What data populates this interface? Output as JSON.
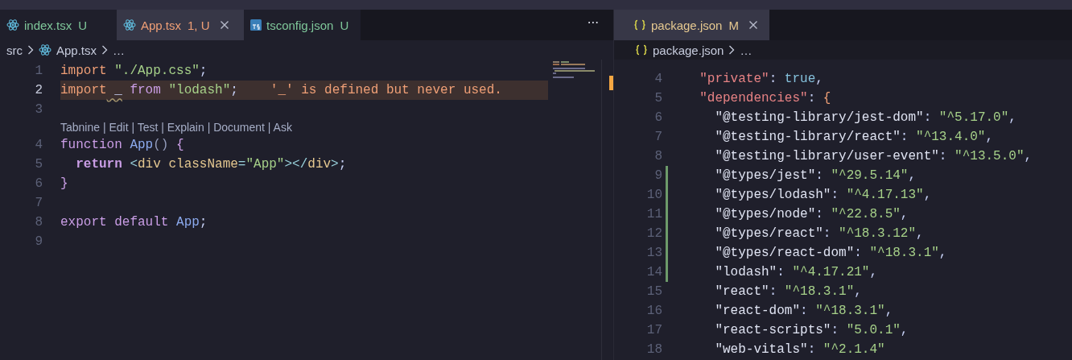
{
  "editor_groups": [
    {
      "tabs": [
        {
          "label": "index.tsx",
          "kind": "react",
          "badge": "U",
          "color": "#7fc79a",
          "selected": false,
          "closable": false
        },
        {
          "label": "App.tsx",
          "kind": "react",
          "badge": "1, U",
          "color": "#ef9f76",
          "selected": true,
          "closable": true
        },
        {
          "label": "tsconfig.json",
          "kind": "typescript",
          "badge": "U",
          "color": "#7fc79a",
          "selected": false,
          "closable": false
        }
      ],
      "more_actions": "···",
      "breadcrumb": [
        {
          "label": "src",
          "kind": "folder"
        },
        {
          "label": "App.tsx",
          "kind": "react"
        },
        {
          "label": "…",
          "kind": "more"
        }
      ],
      "lines": [
        {
          "kind": "code",
          "number": "1",
          "current": false,
          "tokens": [
            {
              "text": "import",
              "kind": "import"
            },
            {
              "text": " \"./App.css\"",
              "kind": "string"
            },
            {
              "text": ";",
              "kind": "plain"
            }
          ]
        },
        {
          "kind": "code",
          "number": "2",
          "current": true,
          "diagnostic": {
            "message": "'_' is defined but never used."
          },
          "tokens": [
            {
              "text": "import",
              "kind": "import"
            },
            {
              "text": " _",
              "kind": "unused"
            },
            {
              "text": " from",
              "kind": "keyword"
            },
            {
              "text": " \"lodash\"",
              "kind": "string"
            },
            {
              "text": ";",
              "kind": "plain"
            }
          ]
        },
        {
          "kind": "code",
          "number": "3",
          "current": false
        },
        {
          "kind": "codelens",
          "text": "Tabnine | Edit | Test | Explain | Document | Ask"
        },
        {
          "kind": "code",
          "number": "4",
          "current": false,
          "tokens": [
            {
              "text": "function",
              "kind": "keyword"
            },
            {
              "text": " App",
              "kind": "func"
            },
            {
              "text": "()",
              "kind": "punct"
            },
            {
              "text": " {",
              "kind": "brace"
            }
          ]
        },
        {
          "kind": "code",
          "number": "5",
          "current": false,
          "tokens": [
            {
              "text": "  return",
              "kind": "bold_keyword"
            },
            {
              "text": " <",
              "kind": "tagpunct"
            },
            {
              "text": "div",
              "kind": "tag"
            },
            {
              "text": " className",
              "kind": "attr"
            },
            {
              "text": "=",
              "kind": "tagpunct"
            },
            {
              "text": "\"App\"",
              "kind": "string"
            },
            {
              "text": "></",
              "kind": "tagpunct"
            },
            {
              "text": "div",
              "kind": "tag"
            },
            {
              "text": ">",
              "kind": "tagpunct"
            },
            {
              "text": ";",
              "kind": "plain"
            }
          ]
        },
        {
          "kind": "code",
          "number": "6",
          "current": false,
          "tokens": [
            {
              "text": "}",
              "kind": "brace"
            }
          ]
        },
        {
          "kind": "code",
          "number": "7",
          "current": false
        },
        {
          "kind": "code",
          "number": "8",
          "current": false,
          "tokens": [
            {
              "text": "export",
              "kind": "keyword"
            },
            {
              "text": " default",
              "kind": "keyword"
            },
            {
              "text": " App",
              "kind": "func"
            },
            {
              "text": ";",
              "kind": "plain"
            }
          ]
        },
        {
          "kind": "code",
          "number": "9",
          "current": false
        }
      ]
    },
    {
      "tabs": [
        {
          "label": "package.json",
          "kind": "json",
          "badge": "M",
          "color": "#e5c890",
          "selected": true,
          "closable": true
        }
      ],
      "breadcrumb": [
        {
          "label": "package.json",
          "kind": "json"
        },
        {
          "label": "…",
          "kind": "more"
        }
      ],
      "lines": [
        {
          "kind": "code",
          "number": "4",
          "current": false,
          "git_added": false,
          "tokens": [
            {
              "text": "  \"private\"",
              "kind": "key"
            },
            {
              "text": ":",
              "kind": "plain"
            },
            {
              "text": " true",
              "kind": "bool"
            },
            {
              "text": ",",
              "kind": "plain"
            }
          ]
        },
        {
          "kind": "code",
          "number": "5",
          "current": false,
          "git_added": false,
          "tokens": [
            {
              "text": "  \"dependencies\"",
              "kind": "key"
            },
            {
              "text": ":",
              "kind": "plain"
            },
            {
              "text": " {",
              "kind": "brace_orange"
            }
          ]
        },
        {
          "kind": "code",
          "number": "6",
          "current": false,
          "git_added": false,
          "tokens": [
            {
              "text": "    \"@testing-library/jest-dom\"",
              "kind": "nested_key"
            },
            {
              "text": ":",
              "kind": "plain"
            },
            {
              "text": " \"^5.17.0\"",
              "kind": "string"
            },
            {
              "text": ",",
              "kind": "plain"
            }
          ]
        },
        {
          "kind": "code",
          "number": "7",
          "current": false,
          "git_added": false,
          "tokens": [
            {
              "text": "    \"@testing-library/react\"",
              "kind": "nested_key"
            },
            {
              "text": ":",
              "kind": "plain"
            },
            {
              "text": " \"^13.4.0\"",
              "kind": "string"
            },
            {
              "text": ",",
              "kind": "plain"
            }
          ]
        },
        {
          "kind": "code",
          "number": "8",
          "current": false,
          "git_added": false,
          "tokens": [
            {
              "text": "    \"@testing-library/user-event\"",
              "kind": "nested_key"
            },
            {
              "text": ":",
              "kind": "plain"
            },
            {
              "text": " \"^13.5.0\"",
              "kind": "string"
            },
            {
              "text": ",",
              "kind": "plain"
            }
          ]
        },
        {
          "kind": "code",
          "number": "9",
          "current": false,
          "git_added": true,
          "tokens": [
            {
              "text": "    \"@types/jest\"",
              "kind": "nested_key"
            },
            {
              "text": ":",
              "kind": "plain"
            },
            {
              "text": " \"^29.5.14\"",
              "kind": "string"
            },
            {
              "text": ",",
              "kind": "plain"
            }
          ]
        },
        {
          "kind": "code",
          "number": "10",
          "current": false,
          "git_added": true,
          "tokens": [
            {
              "text": "    \"@types/lodash\"",
              "kind": "nested_key"
            },
            {
              "text": ":",
              "kind": "plain"
            },
            {
              "text": " \"^4.17.13\"",
              "kind": "string"
            },
            {
              "text": ",",
              "kind": "plain"
            }
          ]
        },
        {
          "kind": "code",
          "number": "11",
          "current": false,
          "git_added": true,
          "tokens": [
            {
              "text": "    \"@types/node\"",
              "kind": "nested_key"
            },
            {
              "text": ":",
              "kind": "plain"
            },
            {
              "text": " \"^22.8.5\"",
              "kind": "string"
            },
            {
              "text": ",",
              "kind": "plain"
            }
          ]
        },
        {
          "kind": "code",
          "number": "12",
          "current": false,
          "git_added": true,
          "tokens": [
            {
              "text": "    \"@types/react\"",
              "kind": "nested_key"
            },
            {
              "text": ":",
              "kind": "plain"
            },
            {
              "text": " \"^18.3.12\"",
              "kind": "string"
            },
            {
              "text": ",",
              "kind": "plain"
            }
          ]
        },
        {
          "kind": "code",
          "number": "13",
          "current": false,
          "git_added": true,
          "tokens": [
            {
              "text": "    \"@types/react-dom\"",
              "kind": "nested_key"
            },
            {
              "text": ":",
              "kind": "plain"
            },
            {
              "text": " \"^18.3.1\"",
              "kind": "string"
            },
            {
              "text": ",",
              "kind": "plain"
            }
          ]
        },
        {
          "kind": "code",
          "number": "14",
          "current": false,
          "git_added": true,
          "tokens": [
            {
              "text": "    \"lodash\"",
              "kind": "nested_key"
            },
            {
              "text": ":",
              "kind": "plain"
            },
            {
              "text": " \"^4.17.21\"",
              "kind": "string"
            },
            {
              "text": ",",
              "kind": "plain"
            }
          ]
        },
        {
          "kind": "code",
          "number": "15",
          "current": false,
          "git_added": false,
          "tokens": [
            {
              "text": "    \"react\"",
              "kind": "nested_key"
            },
            {
              "text": ":",
              "kind": "plain"
            },
            {
              "text": " \"^18.3.1\"",
              "kind": "string"
            },
            {
              "text": ",",
              "kind": "plain"
            }
          ]
        },
        {
          "kind": "code",
          "number": "16",
          "current": false,
          "git_added": false,
          "tokens": [
            {
              "text": "    \"react-dom\"",
              "kind": "nested_key"
            },
            {
              "text": ":",
              "kind": "plain"
            },
            {
              "text": " \"^18.3.1\"",
              "kind": "string"
            },
            {
              "text": ",",
              "kind": "plain"
            }
          ]
        },
        {
          "kind": "code",
          "number": "17",
          "current": false,
          "git_added": false,
          "tokens": [
            {
              "text": "    \"react-scripts\"",
              "kind": "nested_key"
            },
            {
              "text": ":",
              "kind": "plain"
            },
            {
              "text": " \"5.0.1\"",
              "kind": "string"
            },
            {
              "text": ",",
              "kind": "plain"
            }
          ]
        },
        {
          "kind": "code",
          "number": "18",
          "current": false,
          "git_added": false,
          "tokens": [
            {
              "text": "    \"web-vitals\"",
              "kind": "nested_key"
            },
            {
              "text": ":",
              "kind": "plain"
            },
            {
              "text": " \"^2.1.4\"",
              "kind": "string"
            }
          ]
        }
      ]
    }
  ]
}
